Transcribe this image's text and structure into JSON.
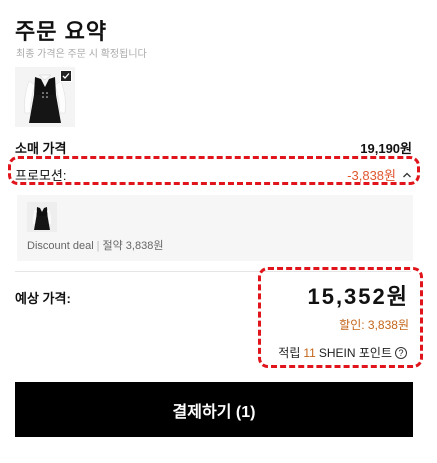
{
  "header": {
    "title": "주문 요약",
    "subtitle": "최종 가격은 주문 시 확정됩니다"
  },
  "summary": {
    "retail_label": "소매 가격",
    "retail_value": "19,190원",
    "promo_label": "프로모션:",
    "promo_value": "-3,838원"
  },
  "deal": {
    "name": "Discount deal",
    "separator": "|",
    "savings": "절약 3,838원"
  },
  "estimate": {
    "label": "예상 가격:",
    "price": "15,352원",
    "discount": "할인: 3,838원",
    "points_prefix": "적립",
    "points_number": "11",
    "points_suffix": "SHEIN 포인트",
    "help_glyph": "?"
  },
  "checkout": {
    "label": "결제하기 (1)"
  },
  "colors": {
    "accent_orange": "#e0572f",
    "discount_brown": "#c4651a",
    "annotation_red": "#e0141a",
    "button_black": "#000000"
  },
  "icons": {
    "checkbox": "checkbox-checked-icon",
    "expand": "chevron-up-icon",
    "help": "question-circle-icon"
  }
}
